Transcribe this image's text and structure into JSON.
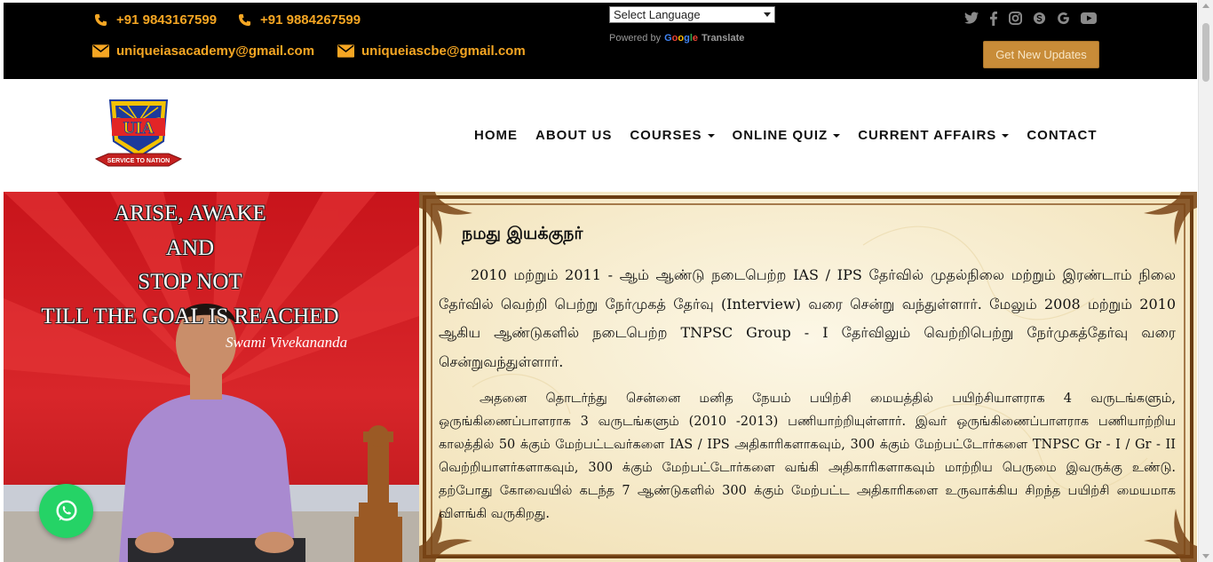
{
  "topbar": {
    "phone1": "+91 9843167599",
    "phone2": "+91 9884267599",
    "email1": "uniqueiasacademy@gmail.com",
    "email2": "uniqueiascbe@gmail.com",
    "language_select": "Select Language",
    "powered_by": "Powered by",
    "google": "Google",
    "translate": "Translate",
    "social": [
      "twitter-icon",
      "facebook-icon",
      "instagram-icon",
      "skype-icon",
      "google-icon",
      "youtube-icon"
    ],
    "updates_button": "Get New Updates"
  },
  "header": {
    "logo_text": "UIA",
    "logo_tagline": "SERVICE TO NATION",
    "nav": [
      {
        "label": "HOME",
        "dropdown": false
      },
      {
        "label": "ABOUT US",
        "dropdown": false
      },
      {
        "label": "COURSES",
        "dropdown": true
      },
      {
        "label": "ONLINE QUIZ",
        "dropdown": true
      },
      {
        "label": "CURRENT AFFAIRS",
        "dropdown": true
      },
      {
        "label": "CONTACT",
        "dropdown": false
      }
    ]
  },
  "hero": {
    "quote_lines": [
      "ARISE, AWAKE",
      "AND",
      "STOP NOT",
      "TILL THE GOAL IS REACHED"
    ],
    "signature": "Swami Vivekananda",
    "title": "நமது இயக்குநர்",
    "paragraph1": "2010 மற்றும் 2011 - ஆம் ஆண்டு நடைபெற்ற IAS / IPS தேர்வில் முதல்நிலை மற்றும் இரண்டாம் நிலை தேர்வில் வெற்றி பெற்று நேர்முகத் தேர்வு (Interview) வரை சென்று வந்துள்ளார். மேலும் 2008 மற்றும் 2010 ஆகிய ஆண்டுகளில் நடைபெற்ற TNPSC Group - I தேர்விலும் வெற்றிபெற்று நேர்முகத்தேர்வு வரை சென்றுவந்துள்ளார்.",
    "paragraph2": "அதனை தொடர்ந்து சென்னை மனித நேயம் பயிற்சி மையத்தில் பயிற்சியாளராக 4 வருடங்களும், ஒருங்கிணைப்பாளராக 3 வருடங்களும் (2010 -2013) பணியாற்றியுள்ளார். இவர் ஒருங்கிணைப்பாளராக பணியாற்றிய காலத்தில் 50 க்கும் மேற்பட்டவர்களை IAS / IPS அதிகாரிகளாகவும், 300 க்கும் மேற்பட்டோர்களை TNPSC Gr - I / Gr - II வெற்றியாளர்களாகவும், 300 க்கும் மேற்பட்டோர்களை வங்கி அதிகாரிகளாகவும் மாற்றிய பெருமை இவருக்கு உண்டு. தற்போது கோவையில் கடந்த 7 ஆண்டுகளில் 300 க்கும் மேற்பட்ட அதிகாரிகளை உருவாக்கிய சிறந்த பயிற்சி மையமாக விளங்கி வருகிறது."
  },
  "whatsapp": "whatsapp-icon"
}
